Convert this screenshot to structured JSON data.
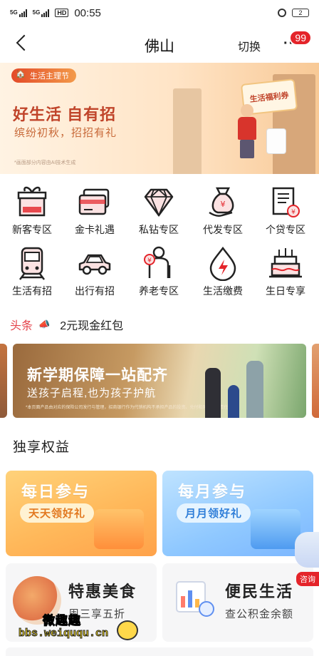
{
  "status_bar": {
    "sig1": "5G",
    "sig2": "5G",
    "hd": "HD",
    "time": "00:55",
    "battery": "2"
  },
  "header": {
    "title": "佛山",
    "switch_label": "切换",
    "more": "···",
    "badge": "99"
  },
  "banner": {
    "tag": "生活主理节",
    "title": "好生活 自有招",
    "subtitle": "缤纷初秋，招招有礼",
    "note": "*画面部分内容由AI技术生成",
    "coupon": "生活福利券"
  },
  "services": [
    {
      "label": "新客专区",
      "icon": "gift-icon"
    },
    {
      "label": "金卡礼遇",
      "icon": "bank-card-icon"
    },
    {
      "label": "私钻专区",
      "icon": "diamond-icon"
    },
    {
      "label": "代发专区",
      "icon": "money-bag-icon"
    },
    {
      "label": "个贷专区",
      "icon": "loan-document-icon"
    },
    {
      "label": "生活有招",
      "icon": "train-icon"
    },
    {
      "label": "出行有招",
      "icon": "car-icon"
    },
    {
      "label": "养老专区",
      "icon": "elderly-icon"
    },
    {
      "label": "生活缴费",
      "icon": "utility-bolt-icon"
    },
    {
      "label": "生日专享",
      "icon": "birthday-cake-icon"
    }
  ],
  "ticker": {
    "tag": "头条",
    "text": "2元现金红包"
  },
  "promo": {
    "title": "新学期保障一站配齐",
    "subtitle": "送孩子启程,也为孩子护航",
    "note": "*本页面产品由对应的保险公司发行与管理，招商银行作为代销机构不承担产品的投资、兑付和风险管理责任"
  },
  "section_title": "独享权益",
  "rights": {
    "daily": {
      "title": "每日参与",
      "pill": "天天领好礼"
    },
    "monthly": {
      "title": "每月参与",
      "pill": "月月领好礼"
    },
    "food": {
      "title": "特惠美食",
      "subtitle": "周三享五折"
    },
    "life": {
      "title": "便民生活",
      "subtitle": "查公积金余额"
    }
  },
  "consult": {
    "label": "咨询"
  },
  "watermark": {
    "line1": "微趣趣",
    "line2": "bbs.weiququ.cn"
  },
  "colors": {
    "brand_red": "#e4242a",
    "accent_orange": "#c0442a"
  }
}
